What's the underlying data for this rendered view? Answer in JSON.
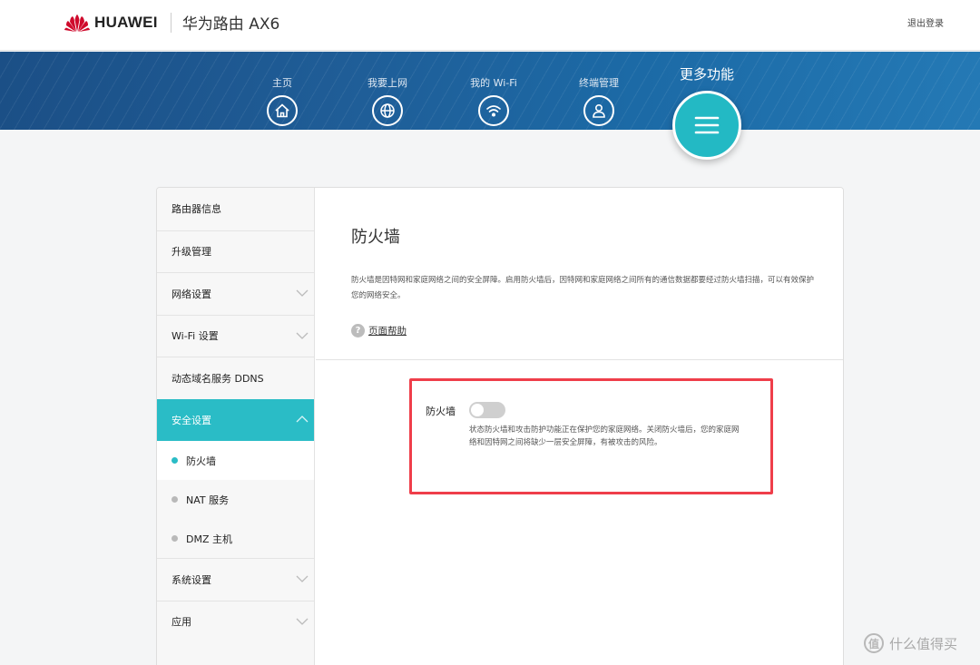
{
  "header": {
    "brand": "HUAWEI",
    "product": "华为路由 AX6",
    "logout": "退出登录",
    "brand_color": "#cf0a2c"
  },
  "nav": {
    "items": [
      {
        "label": "主页",
        "icon": "home-icon"
      },
      {
        "label": "我要上网",
        "icon": "globe-icon"
      },
      {
        "label": "我的 Wi-Fi",
        "icon": "wifi-icon"
      },
      {
        "label": "终端管理",
        "icon": "user-icon"
      }
    ],
    "more": {
      "label": "更多功能",
      "icon": "menu-icon"
    },
    "accent_color": "#23b9c4"
  },
  "sidebar": {
    "items": [
      {
        "label": "路由器信息"
      },
      {
        "label": "升级管理"
      },
      {
        "label": "网络设置",
        "expandable": true
      },
      {
        "label": "Wi-Fi 设置",
        "expandable": true
      },
      {
        "label": "动态域名服务 DDNS"
      },
      {
        "label": "安全设置",
        "expandable": true,
        "expanded": true
      }
    ],
    "subitems": [
      {
        "label": "防火墙",
        "selected": true
      },
      {
        "label": "NAT 服务"
      },
      {
        "label": "DMZ 主机"
      }
    ],
    "items_after": [
      {
        "label": "系统设置",
        "expandable": true
      },
      {
        "label": "应用",
        "expandable": true
      }
    ]
  },
  "main": {
    "title": "防火墙",
    "description": "防火墙是因特网和家庭网络之间的安全屏障。启用防火墙后，因特网和家庭网络之间所有的通信数据都要经过防火墙扫描，可以有效保护您的网络安全。",
    "help_link": "页面帮助",
    "setting": {
      "label": "防火墙",
      "enabled": false,
      "description": "状态防火墙和攻击防护功能正在保护您的家庭网络。关闭防火墙后，您的家庭网络和因特网之间将缺少一层安全屏障，有被攻击的风险。"
    },
    "highlight_color": "#ef3e4a"
  },
  "watermark": {
    "text": "什么值得买",
    "logo": "值"
  }
}
